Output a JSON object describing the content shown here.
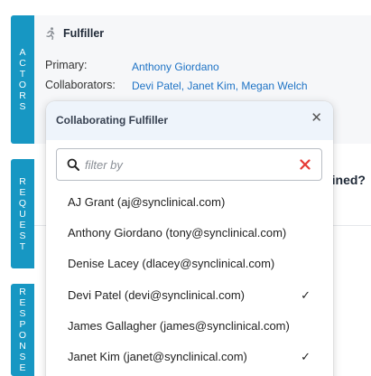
{
  "tabs": {
    "actors": "ACTORS",
    "request": "REQUEST",
    "response": "RESPONSE"
  },
  "actors": {
    "heading": "Fulfiller",
    "primary_label": "Primary:",
    "primary_value": "Anthony Giordano",
    "collaborators_label": "Collaborators:",
    "collaborators_value": "Devi Patel, Janet Kim, Megan Welch"
  },
  "request": {
    "question_fragment": "ined?"
  },
  "popup": {
    "title": "Collaborating Fulfiller",
    "close_glyph": "✕",
    "search_placeholder": "filter by",
    "search_value": "",
    "options": [
      {
        "label": "AJ Grant (aj@synclinical.com)",
        "check": ""
      },
      {
        "label": "Anthony Giordano (tony@synclinical.com)",
        "check": ""
      },
      {
        "label": "Denise Lacey (dlacey@synclinical.com)",
        "check": ""
      },
      {
        "label": "Devi Patel (devi@synclinical.com)",
        "check": "✓"
      },
      {
        "label": "James Gallagher (james@synclinical.com)",
        "check": ""
      },
      {
        "label": "Janet Kim (janet@synclinical.com)",
        "check": "✓"
      }
    ]
  },
  "colors": {
    "tab_accent": "#1797c3",
    "link_blue": "#1e73c5",
    "clear_red": "#e53935",
    "popup_header_bg": "#eef4fb"
  },
  "icons": {
    "actors_heading": "running-person-icon",
    "search": "search-icon",
    "clear": "clear-x-icon",
    "close": "close-icon"
  }
}
